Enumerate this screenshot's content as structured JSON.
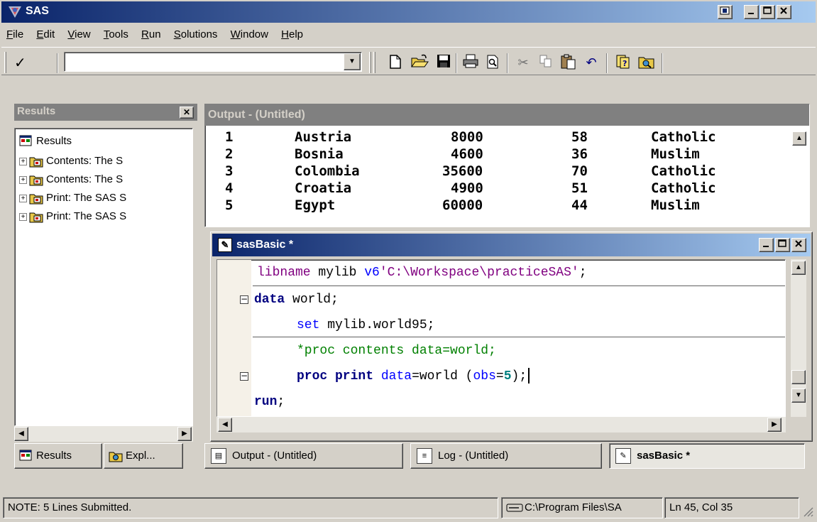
{
  "window": {
    "title": "SAS"
  },
  "menu": [
    {
      "label": "File",
      "key": "F",
      "rest": "ile"
    },
    {
      "label": "Edit",
      "key": "E",
      "rest": "dit"
    },
    {
      "label": "View",
      "key": "V",
      "rest": "iew"
    },
    {
      "label": "Tools",
      "key": "T",
      "rest": "ools"
    },
    {
      "label": "Run",
      "key": "R",
      "rest": "un"
    },
    {
      "label": "Solutions",
      "key": "S",
      "rest": "olutions"
    },
    {
      "label": "Window",
      "key": "W",
      "rest": "indow"
    },
    {
      "label": "Help",
      "key": "H",
      "rest": "elp"
    }
  ],
  "toolbar": {
    "command_value": "",
    "icons": [
      "checkmark-icon",
      "new-icon",
      "open-icon",
      "save-icon",
      "print-icon",
      "print-preview-icon",
      "cut-icon",
      "copy-icon",
      "paste-icon",
      "undo-icon",
      "help-icon",
      "explorer-icon"
    ]
  },
  "results": {
    "title": "Results",
    "root": "Results",
    "items": [
      "Contents:  The S",
      "Contents:  The S",
      "Print:  The SAS S",
      "Print:  The SAS S"
    ],
    "tabs": [
      "Results",
      "Expl..."
    ]
  },
  "output": {
    "title": "Output - (Untitled)",
    "rows": [
      [
        "1",
        "Austria",
        "8000",
        "58",
        "Catholic"
      ],
      [
        "2",
        "Bosnia",
        "4600",
        "36",
        "Muslim"
      ],
      [
        "3",
        "Colombia",
        "35600",
        "70",
        "Catholic"
      ],
      [
        "4",
        "Croatia",
        "4900",
        "51",
        "Catholic"
      ],
      [
        "5",
        "Egypt",
        "60000",
        "44",
        "Muslim"
      ]
    ]
  },
  "editor": {
    "title": "sasBasic *",
    "code": {
      "l1_kw": "libname",
      "l1_mid": " mylib ",
      "l1_opt": "v6",
      "l1_str": "'C:\\Workspace\\practiceSAS'",
      "l1_end": ";",
      "l2_kw": "data",
      "l2_rest": " world;",
      "l3_kw": "set",
      "l3_rest": " mylib.world95;",
      "l4_cmt": "*proc contents data=world;",
      "l5_kw": "proc print",
      "l5_sp": " ",
      "l5_opt1": "data",
      "l5_mid": "=world (",
      "l5_opt2": "obs",
      "l5_eq": "=",
      "l5_num": "5",
      "l5_end": ");",
      "l6_kw": "run",
      "l6_end": ";"
    }
  },
  "tabs": [
    "Output - (Untitled)",
    "Log - (Untitled)",
    "sasBasic *"
  ],
  "status": {
    "note": "NOTE:  5 Lines Submitted.",
    "path": "C:\\Program Files\\SA",
    "position": "Ln 45, Col 35"
  }
}
